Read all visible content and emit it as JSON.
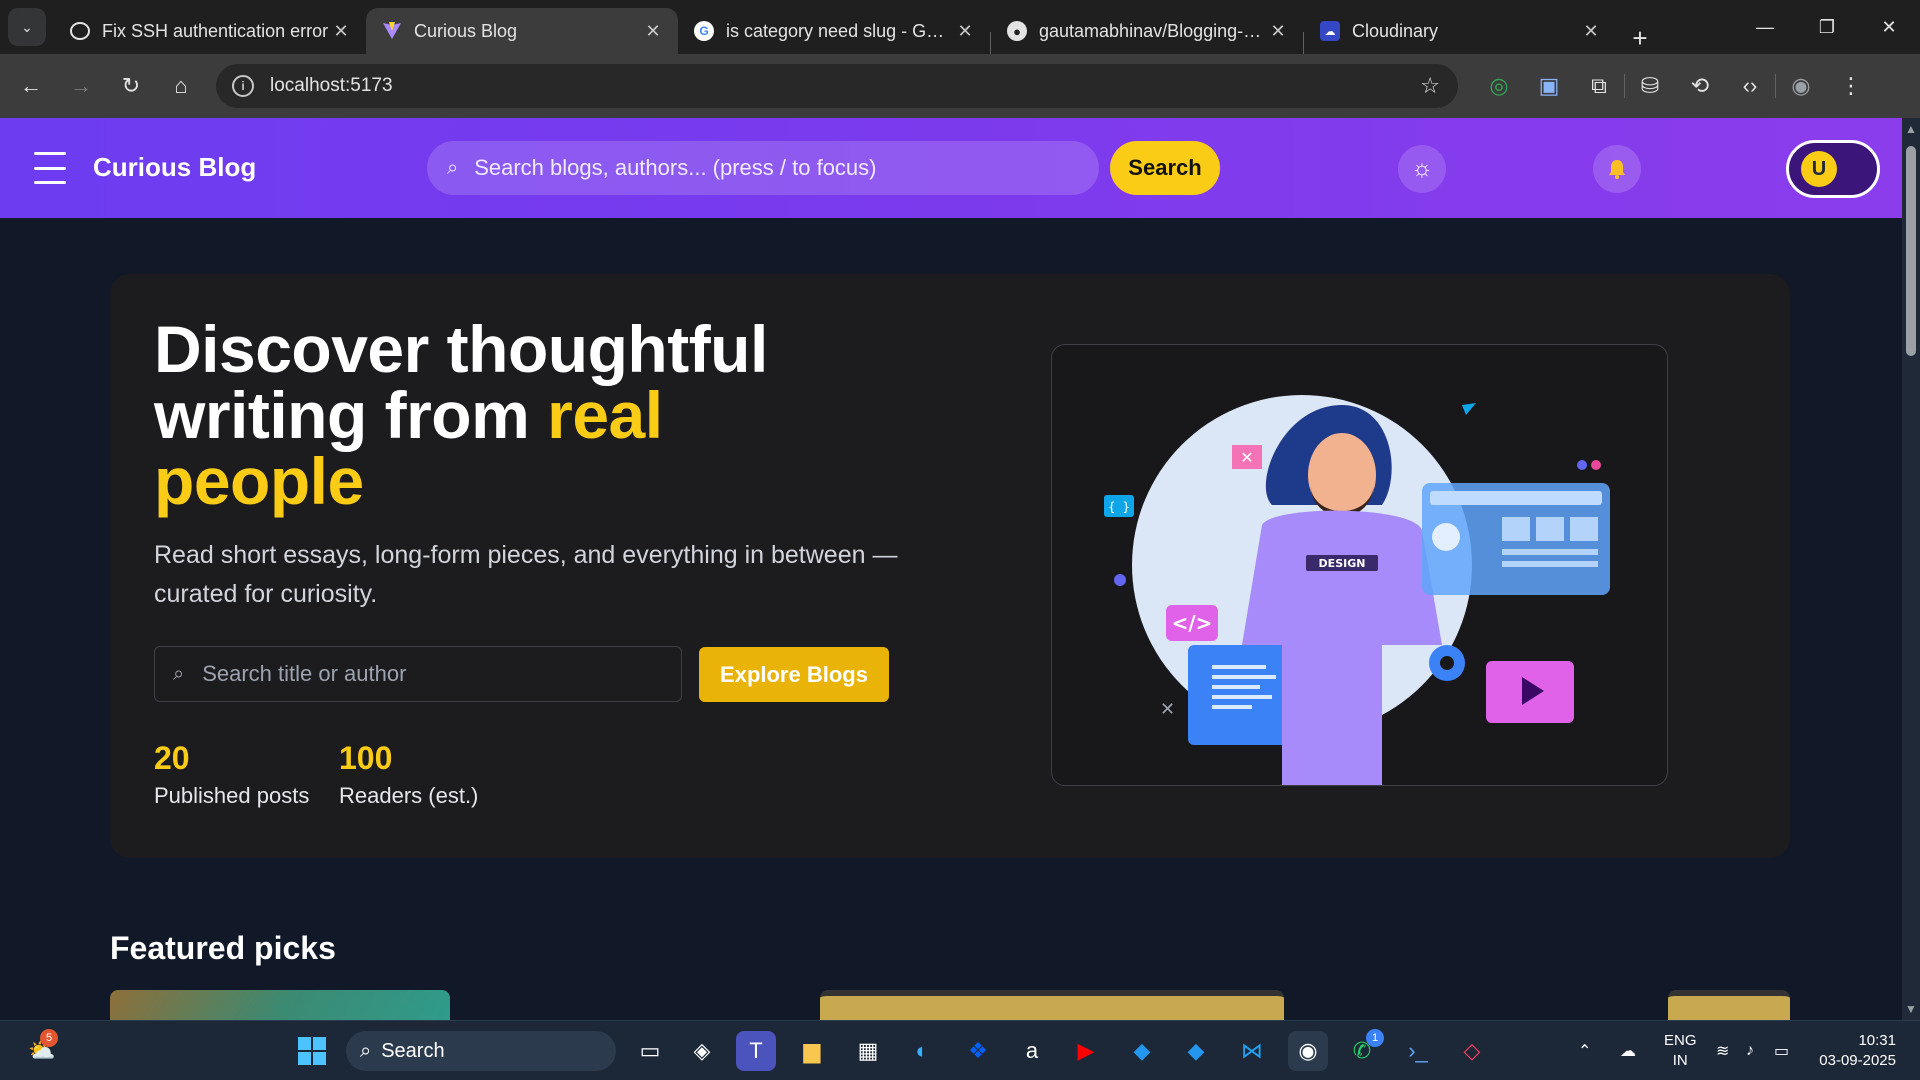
{
  "browser": {
    "tabs": [
      {
        "title": "Fix SSH authentication error",
        "favicon": "openai-icon"
      },
      {
        "title": "Curious Blog",
        "favicon": "vite-icon",
        "active": true
      },
      {
        "title": "is category need slug - Googl",
        "favicon": "google-icon"
      },
      {
        "title": "gautamabhinav/Blogging-Pla",
        "favicon": "github-icon"
      },
      {
        "title": "Cloudinary",
        "favicon": "cloudinary-icon"
      }
    ],
    "url": "localhost:5173"
  },
  "site": {
    "brand": "Curious Blog",
    "header_search_placeholder": "Search blogs, authors... (press / to focus)",
    "header_search_button": "Search",
    "avatar_initial": "U"
  },
  "hero": {
    "title_part1": "Discover thoughtful writing from ",
    "title_accent": "real people",
    "subtitle": "Read short essays, long-form pieces, and everything in between — curated for curiosity.",
    "search_placeholder": "Search title or author",
    "explore_button": "Explore Blogs",
    "stats": [
      {
        "value": "20",
        "label": "Published posts"
      },
      {
        "value": "100",
        "label": "Readers (est.)"
      }
    ],
    "illustration_badge": "DESIGN"
  },
  "featured": {
    "heading": "Featured picks"
  },
  "colors": {
    "header_gradient_start": "#6d3cf0",
    "header_gradient_end": "#8b3dec",
    "accent_yellow": "#facc15",
    "page_bg": "#111827",
    "hero_bg": "#1c1c1f"
  },
  "taskbar": {
    "search_label": "Search",
    "weather_badge": "5",
    "whatsapp_badge": "1",
    "lang_line1": "ENG",
    "lang_line2": "IN",
    "time": "10:31",
    "date": "03-09-2025"
  }
}
